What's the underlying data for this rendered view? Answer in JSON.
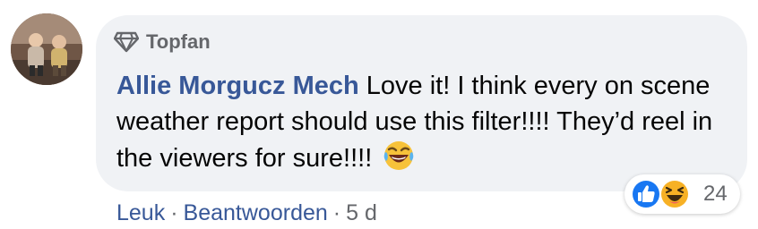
{
  "comment": {
    "badge_label": "Topfan",
    "author": "Allie Morgucz Mech",
    "text": "Love it! I think every on scene weather report should use this filter!!!! They’d reel in the viewers for sure!!!!",
    "emoji": "laughing-crying-face"
  },
  "reactions": {
    "types": [
      "like",
      "haha"
    ],
    "count": "24"
  },
  "actions": {
    "like_label": "Leuk",
    "reply_label": "Beantwoorden",
    "separator": "·",
    "timestamp": "5 d"
  },
  "colors": {
    "author": "#385898",
    "bubble": "#f0f2f5",
    "muted": "#65676b",
    "like_blue": "#1877f2",
    "haha_yellow": "#f7b125"
  }
}
